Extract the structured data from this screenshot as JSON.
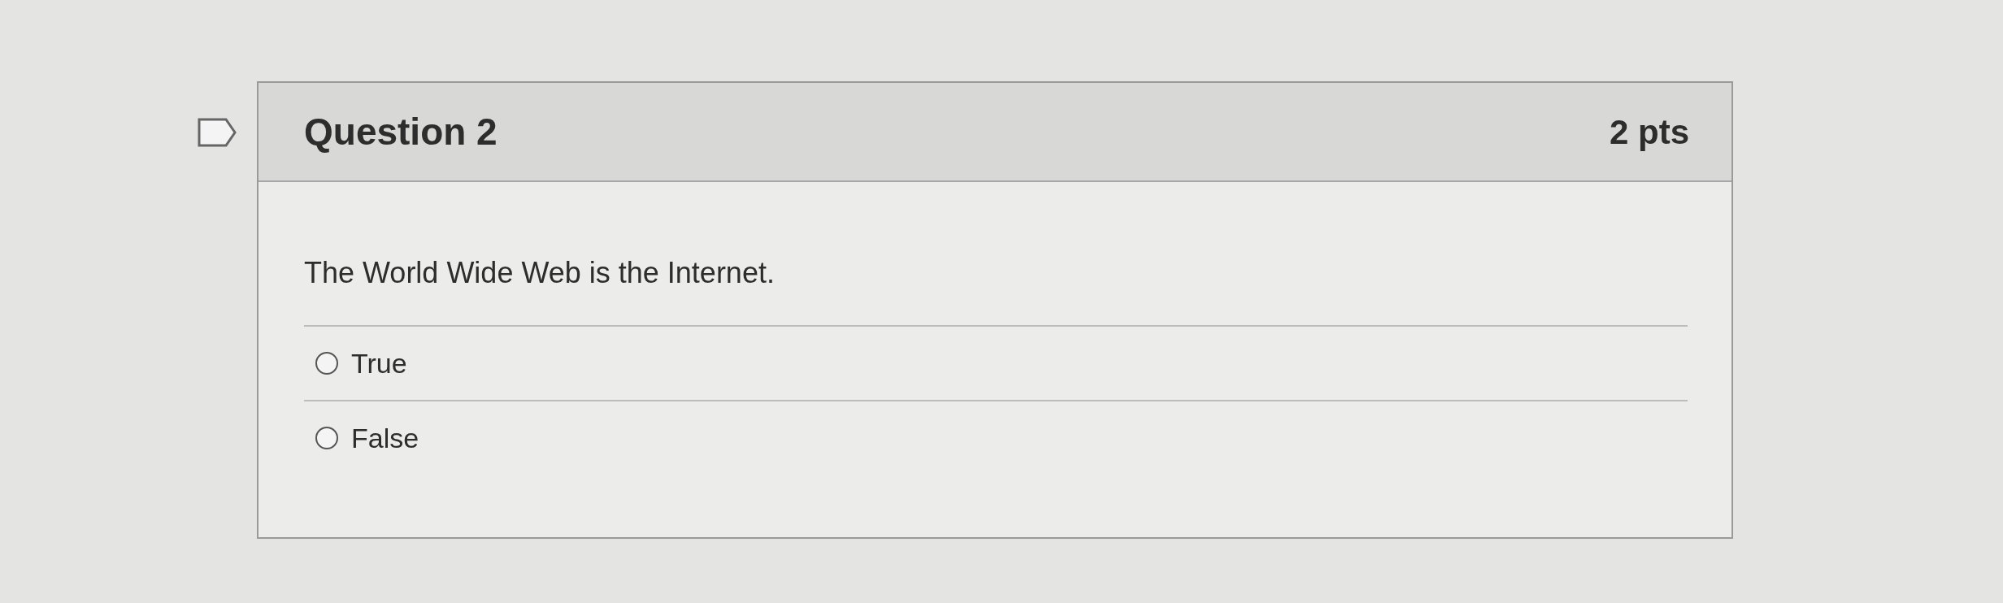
{
  "question": {
    "title": "Question 2",
    "points": "2 pts",
    "flagged": false,
    "text": "The World Wide Web is the Internet.",
    "answers": [
      {
        "label": "True",
        "selected": false
      },
      {
        "label": "False",
        "selected": false
      }
    ]
  }
}
